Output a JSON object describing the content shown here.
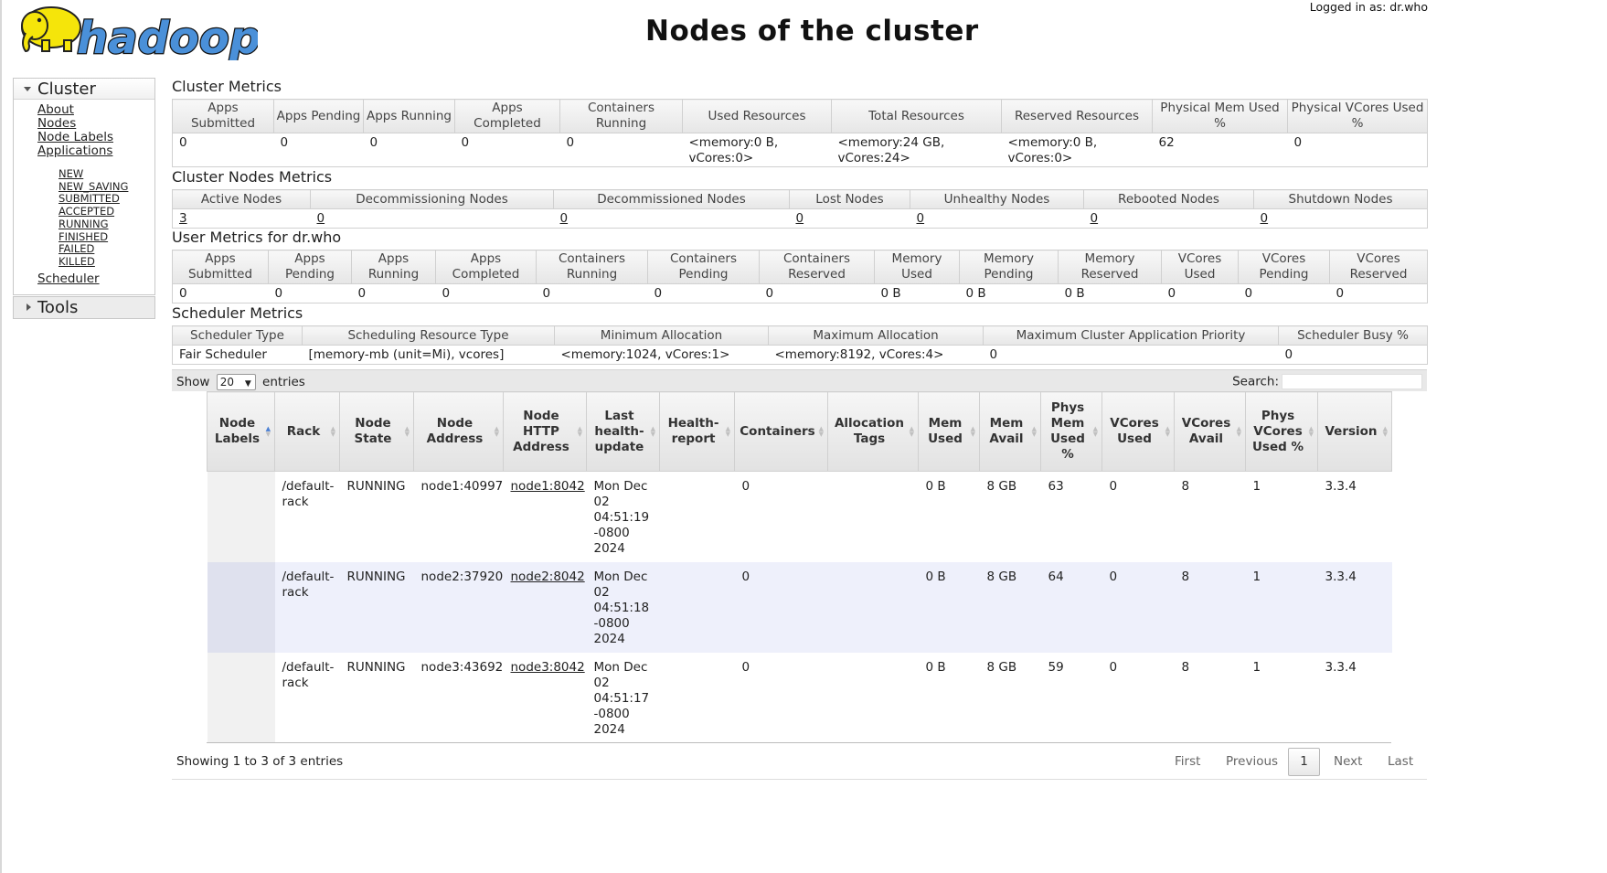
{
  "header": {
    "logo_text": "hadoop",
    "title": "Nodes of the cluster",
    "logged_in": "Logged in as: dr.who"
  },
  "sidebar": {
    "cluster_label": "Cluster",
    "links": [
      "About",
      "Nodes",
      "Node Labels",
      "Applications"
    ],
    "app_states": [
      "NEW",
      "NEW_SAVING",
      "SUBMITTED",
      "ACCEPTED",
      "RUNNING",
      "FINISHED",
      "FAILED",
      "KILLED"
    ],
    "scheduler_label": "Scheduler",
    "tools_label": "Tools"
  },
  "cluster_metrics": {
    "title": "Cluster Metrics",
    "headers": [
      "Apps Submitted",
      "Apps Pending",
      "Apps Running",
      "Apps Completed",
      "Containers Running",
      "Used Resources",
      "Total Resources",
      "Reserved Resources",
      "Physical Mem Used %",
      "Physical VCores Used %"
    ],
    "values": [
      "0",
      "0",
      "0",
      "0",
      "0",
      "<memory:0 B, vCores:0>",
      "<memory:24 GB, vCores:24>",
      "<memory:0 B, vCores:0>",
      "62",
      "0"
    ]
  },
  "node_metrics": {
    "title": "Cluster Nodes Metrics",
    "headers": [
      "Active Nodes",
      "Decommissioning Nodes",
      "Decommissioned Nodes",
      "Lost Nodes",
      "Unhealthy Nodes",
      "Rebooted Nodes",
      "Shutdown Nodes"
    ],
    "values": [
      "3",
      "0",
      "0",
      "0",
      "0",
      "0",
      "0"
    ]
  },
  "user_metrics": {
    "title": "User Metrics for dr.who",
    "headers": [
      "Apps Submitted",
      "Apps Pending",
      "Apps Running",
      "Apps Completed",
      "Containers Running",
      "Containers Pending",
      "Containers Reserved",
      "Memory Used",
      "Memory Pending",
      "Memory Reserved",
      "VCores Used",
      "VCores Pending",
      "VCores Reserved"
    ],
    "values": [
      "0",
      "0",
      "0",
      "0",
      "0",
      "0",
      "0",
      "0 B",
      "0 B",
      "0 B",
      "0",
      "0",
      "0"
    ]
  },
  "scheduler_metrics": {
    "title": "Scheduler Metrics",
    "headers": [
      "Scheduler Type",
      "Scheduling Resource Type",
      "Minimum Allocation",
      "Maximum Allocation",
      "Maximum Cluster Application Priority",
      "Scheduler Busy %"
    ],
    "values": [
      "Fair Scheduler",
      "[memory-mb (unit=Mi), vcores]",
      "<memory:1024, vCores:1>",
      "<memory:8192, vCores:4>",
      "0",
      "0"
    ]
  },
  "nodes_table": {
    "show_label": "Show",
    "page_size": "20",
    "entries_label": "entries",
    "search_label": "Search:",
    "headers": [
      "Node Labels",
      "Rack",
      "Node State",
      "Node Address",
      "Node HTTP Address",
      "Last health-update",
      "Health-report",
      "Containers",
      "Allocation Tags",
      "Mem Used",
      "Mem Avail",
      "Phys Mem Used %",
      "VCores Used",
      "VCores Avail",
      "Phys VCores Used %",
      "Version"
    ],
    "rows": [
      [
        "",
        "/default-rack",
        "RUNNING",
        "node1:40997",
        "node1:8042",
        "Mon Dec 02 04:51:19 -0800 2024",
        "",
        "0",
        "",
        "0 B",
        "8 GB",
        "63",
        "0",
        "8",
        "1",
        "3.3.4"
      ],
      [
        "",
        "/default-rack",
        "RUNNING",
        "node2:37920",
        "node2:8042",
        "Mon Dec 02 04:51:18 -0800 2024",
        "",
        "0",
        "",
        "0 B",
        "8 GB",
        "64",
        "0",
        "8",
        "1",
        "3.3.4"
      ],
      [
        "",
        "/default-rack",
        "RUNNING",
        "node3:43692",
        "node3:8042",
        "Mon Dec 02 04:51:17 -0800 2024",
        "",
        "0",
        "",
        "0 B",
        "8 GB",
        "59",
        "0",
        "8",
        "1",
        "3.3.4"
      ]
    ],
    "info": "Showing 1 to 3 of 3 entries",
    "pagination": {
      "first": "First",
      "previous": "Previous",
      "current": "1",
      "next": "Next",
      "last": "Last"
    }
  },
  "colors": {
    "even_row": "#eef0fb",
    "logo_yellow": "#f5e50a",
    "logo_blue": "#4a90d9"
  }
}
